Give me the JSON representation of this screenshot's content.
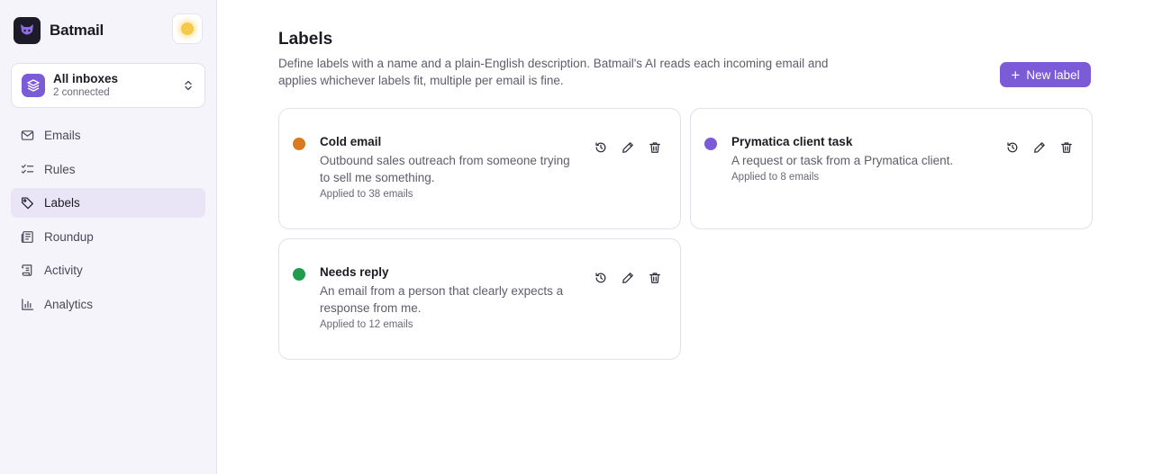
{
  "app": {
    "name": "Batmail"
  },
  "inbox_switcher": {
    "title": "All inboxes",
    "subtitle": "2 connected"
  },
  "nav": {
    "items": [
      {
        "label": "Emails",
        "icon": "mail-icon"
      },
      {
        "label": "Rules",
        "icon": "checklist-icon"
      },
      {
        "label": "Labels",
        "icon": "tag-icon",
        "active": true
      },
      {
        "label": "Roundup",
        "icon": "newspaper-icon"
      },
      {
        "label": "Activity",
        "icon": "scroll-icon"
      },
      {
        "label": "Analytics",
        "icon": "bar-chart-icon"
      }
    ]
  },
  "page": {
    "title": "Labels",
    "description": "Define labels with a name and a plain-English description. Batmail's AI reads each incoming email and applies whichever labels fit, multiple per email is fine.",
    "new_label_button": "New label"
  },
  "labels": [
    {
      "name": "Cold email",
      "description": "Outbound sales outreach from someone trying to sell me something.",
      "applied": "Applied to 38 emails",
      "color": "#d97a1e"
    },
    {
      "name": "Prymatica client task",
      "description": "A request or task from a Prymatica client.",
      "applied": "Applied to 8 emails",
      "color": "#7b5bd6"
    },
    {
      "name": "Needs reply",
      "description": "An email from a person that clearly expects a response from me.",
      "applied": "Applied to 12 emails",
      "color": "#1f9d4c"
    }
  ],
  "colors": {
    "accent": "#7b5bd6",
    "sidebar_bg": "#f6f4fb"
  }
}
